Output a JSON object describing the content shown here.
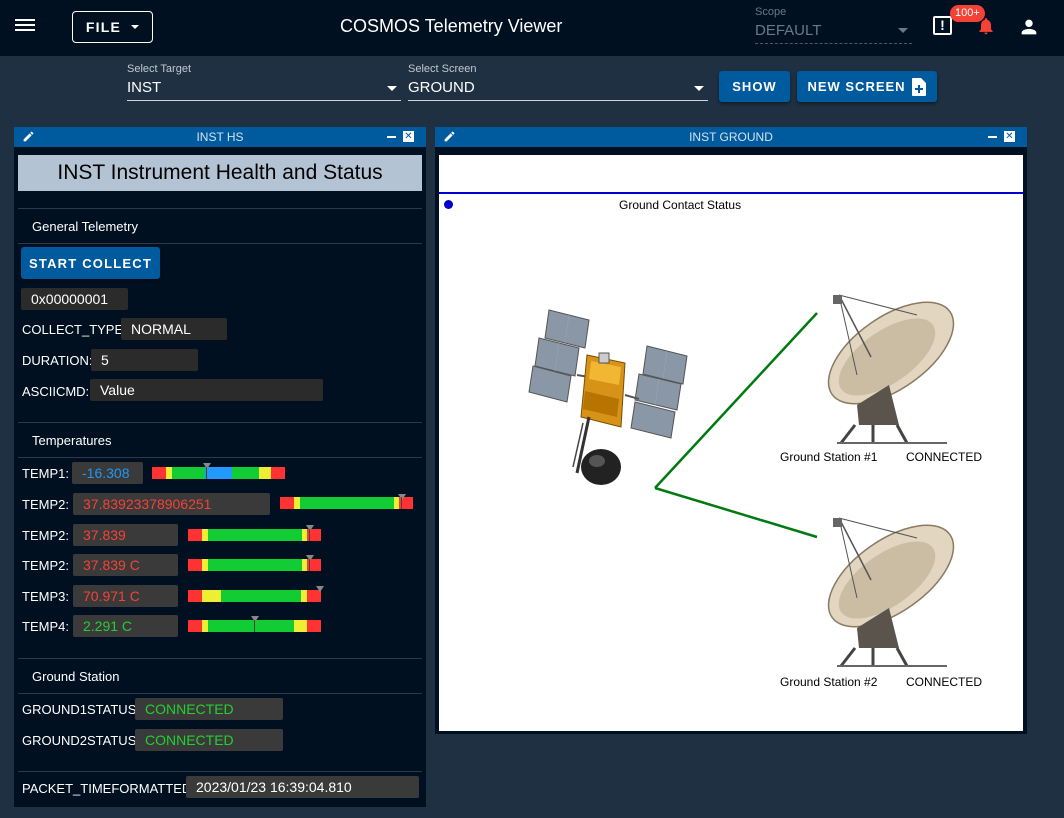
{
  "app": {
    "title": "COSMOS Telemetry Viewer",
    "file_label": "FILE"
  },
  "scope": {
    "label": "Scope",
    "value": "DEFAULT"
  },
  "notifications": {
    "badge": "100+",
    "alert_glyph": "!"
  },
  "selectors": {
    "target_label": "Select Target",
    "target_value": "INST",
    "screen_label": "Select Screen",
    "screen_value": "GROUND",
    "show_label": "SHOW",
    "new_screen_label": "NEW SCREEN"
  },
  "hs_panel": {
    "header": "INST HS",
    "title": "INST Instrument Health and Status",
    "general_label": "General Telemetry",
    "start_collect": "START COLLECT",
    "hex_value": "0x00000001",
    "collect_type_label": "COLLECT_TYPE:",
    "collect_type_value": "NORMAL",
    "duration_label": "DURATION:",
    "duration_value": "5",
    "asciicmd_label": "ASCIICMD:",
    "asciicmd_placeholder": "Value",
    "temperatures_label": "Temperatures",
    "temps": [
      {
        "label": "TEMP1:",
        "value": "-16.308",
        "color": "#2196f3",
        "marker": 0.41
      },
      {
        "label": "TEMP2:",
        "value": "37.83923378906251",
        "color": "#f44336",
        "marker": 0.91
      },
      {
        "label": "TEMP2:",
        "value": "37.839",
        "color": "#f44336",
        "marker": 0.91
      },
      {
        "label": "TEMP2:",
        "value": "37.839 C",
        "color": "#f44336",
        "marker": 0.91
      },
      {
        "label": "TEMP3:",
        "value": "70.971 C",
        "color": "#f44336",
        "marker": 0.99
      },
      {
        "label": "TEMP4:",
        "value": "2.291 C",
        "color": "#22d030",
        "marker": 0.5
      }
    ],
    "ground_label": "Ground Station",
    "ground1_label": "GROUND1STATUS:",
    "ground1_value": "CONNECTED",
    "ground2_label": "GROUND2STATUS:",
    "ground2_value": "CONNECTED",
    "packet_time_label": "PACKET_TIMEFORMATTED:",
    "packet_time_value": "2023/01/23 16:39:04.810"
  },
  "ground_panel": {
    "header": "INST GROUND",
    "status_title": "Ground Contact Status",
    "station1_label": "Ground Station #1",
    "station1_status": "CONNECTED",
    "station2_label": "Ground Station #2",
    "station2_status": "CONNECTED"
  },
  "colors": {
    "accent": "#005a9e",
    "appbar": "#001021",
    "background": "#1e3041",
    "link_line": "#007a10"
  }
}
